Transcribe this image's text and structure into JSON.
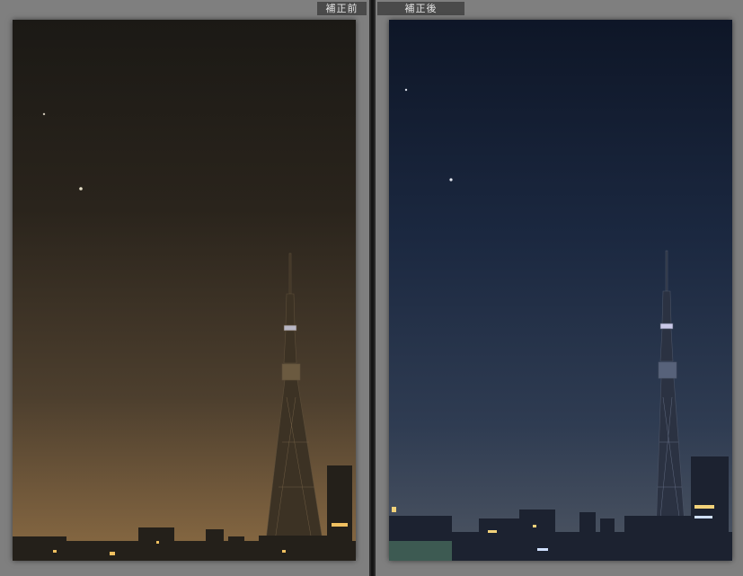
{
  "panels": {
    "before": {
      "label": "補正前"
    },
    "after": {
      "label": "補正後"
    }
  },
  "colors": {
    "background": "#7d7d7d",
    "divider": "#151515",
    "tab": "#4a4a4a",
    "before_sky_top": "#1b1915",
    "before_sky_bottom": "#8a6b42",
    "after_sky_top": "#0e1627",
    "after_sky_bottom": "#4a5568"
  }
}
